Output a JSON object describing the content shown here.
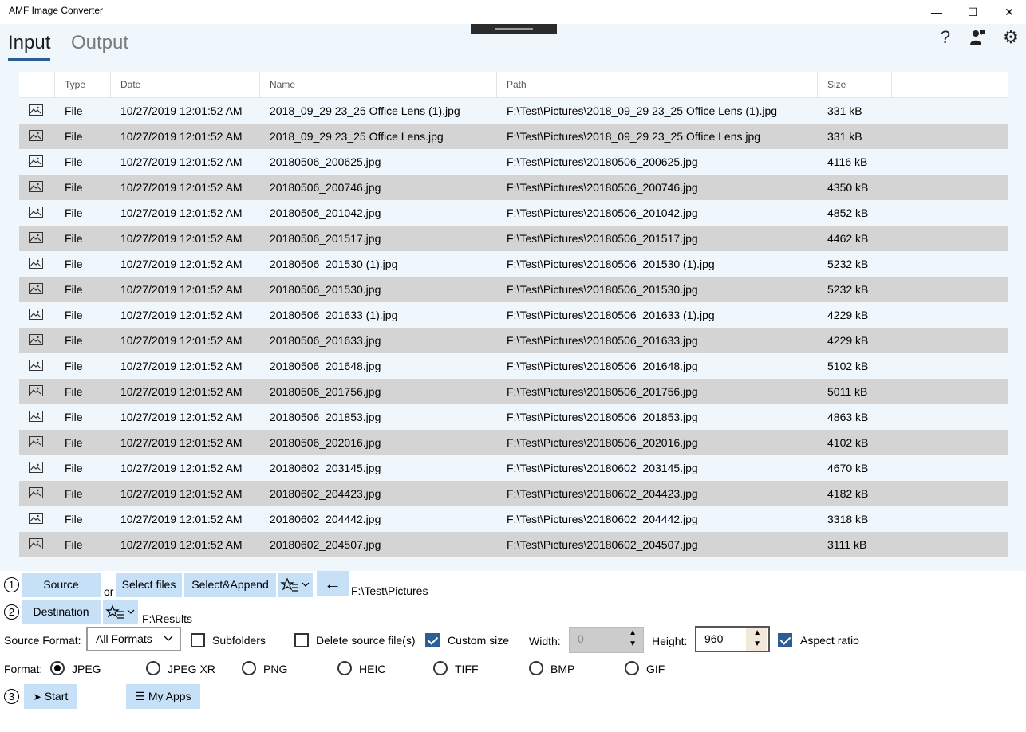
{
  "window": {
    "title": "AMF Image Converter",
    "minimize_icon": "—",
    "maximize_icon": "☐",
    "close_icon": "✕"
  },
  "tabs": {
    "input": "Input",
    "output": "Output"
  },
  "top_icons": {
    "help": "?",
    "settings": "⚙"
  },
  "grid": {
    "headers": {
      "icon": "",
      "type": "Type",
      "date": "Date",
      "name": "Name",
      "path": "Path",
      "size": "Size"
    },
    "rows": [
      {
        "type": "File",
        "date": "10/27/2019 12:01:52 AM",
        "name": "2018_09_29 23_25 Office Lens (1).jpg",
        "path": "F:\\Test\\Pictures\\2018_09_29 23_25 Office Lens (1).jpg",
        "size": "331 kB"
      },
      {
        "type": "File",
        "date": "10/27/2019 12:01:52 AM",
        "name": "2018_09_29 23_25 Office Lens.jpg",
        "path": "F:\\Test\\Pictures\\2018_09_29 23_25 Office Lens.jpg",
        "size": "331 kB"
      },
      {
        "type": "File",
        "date": "10/27/2019 12:01:52 AM",
        "name": "20180506_200625.jpg",
        "path": "F:\\Test\\Pictures\\20180506_200625.jpg",
        "size": "4116 kB"
      },
      {
        "type": "File",
        "date": "10/27/2019 12:01:52 AM",
        "name": "20180506_200746.jpg",
        "path": "F:\\Test\\Pictures\\20180506_200746.jpg",
        "size": "4350 kB"
      },
      {
        "type": "File",
        "date": "10/27/2019 12:01:52 AM",
        "name": "20180506_201042.jpg",
        "path": "F:\\Test\\Pictures\\20180506_201042.jpg",
        "size": "4852 kB"
      },
      {
        "type": "File",
        "date": "10/27/2019 12:01:52 AM",
        "name": "20180506_201517.jpg",
        "path": "F:\\Test\\Pictures\\20180506_201517.jpg",
        "size": "4462 kB"
      },
      {
        "type": "File",
        "date": "10/27/2019 12:01:52 AM",
        "name": "20180506_201530 (1).jpg",
        "path": "F:\\Test\\Pictures\\20180506_201530 (1).jpg",
        "size": "5232 kB"
      },
      {
        "type": "File",
        "date": "10/27/2019 12:01:52 AM",
        "name": "20180506_201530.jpg",
        "path": "F:\\Test\\Pictures\\20180506_201530.jpg",
        "size": "5232 kB"
      },
      {
        "type": "File",
        "date": "10/27/2019 12:01:52 AM",
        "name": "20180506_201633 (1).jpg",
        "path": "F:\\Test\\Pictures\\20180506_201633 (1).jpg",
        "size": "4229 kB"
      },
      {
        "type": "File",
        "date": "10/27/2019 12:01:52 AM",
        "name": "20180506_201633.jpg",
        "path": "F:\\Test\\Pictures\\20180506_201633.jpg",
        "size": "4229 kB"
      },
      {
        "type": "File",
        "date": "10/27/2019 12:01:52 AM",
        "name": "20180506_201648.jpg",
        "path": "F:\\Test\\Pictures\\20180506_201648.jpg",
        "size": "5102 kB"
      },
      {
        "type": "File",
        "date": "10/27/2019 12:01:52 AM",
        "name": "20180506_201756.jpg",
        "path": "F:\\Test\\Pictures\\20180506_201756.jpg",
        "size": "5011 kB"
      },
      {
        "type": "File",
        "date": "10/27/2019 12:01:52 AM",
        "name": "20180506_201853.jpg",
        "path": "F:\\Test\\Pictures\\20180506_201853.jpg",
        "size": "4863 kB"
      },
      {
        "type": "File",
        "date": "10/27/2019 12:01:52 AM",
        "name": "20180506_202016.jpg",
        "path": "F:\\Test\\Pictures\\20180506_202016.jpg",
        "size": "4102 kB"
      },
      {
        "type": "File",
        "date": "10/27/2019 12:01:52 AM",
        "name": "20180602_203145.jpg",
        "path": "F:\\Test\\Pictures\\20180602_203145.jpg",
        "size": "4670 kB"
      },
      {
        "type": "File",
        "date": "10/27/2019 12:01:52 AM",
        "name": "20180602_204423.jpg",
        "path": "F:\\Test\\Pictures\\20180602_204423.jpg",
        "size": "4182 kB"
      },
      {
        "type": "File",
        "date": "10/27/2019 12:01:52 AM",
        "name": "20180602_204442.jpg",
        "path": "F:\\Test\\Pictures\\20180602_204442.jpg",
        "size": "3318 kB"
      },
      {
        "type": "File",
        "date": "10/27/2019 12:01:52 AM",
        "name": "20180602_204507.jpg",
        "path": "F:\\Test\\Pictures\\20180602_204507.jpg",
        "size": "3111 kB"
      }
    ]
  },
  "controls": {
    "step1": "1",
    "step2": "2",
    "step3": "3",
    "source_button": "Source",
    "or_label": "or",
    "select_files_button": "Select files",
    "select_append_button": "Select&Append",
    "back_icon": "←",
    "source_path": "F:\\Test\\Pictures",
    "destination_button": "Destination",
    "destination_path": "F:\\Results",
    "source_format_label": "Source Format:",
    "source_format_value": "All Formats",
    "subfolders_label": "Subfolders",
    "delete_source_label": "Delete source file(s)",
    "custom_size_label": "Custom size",
    "width_label": "Width:",
    "width_value": "0",
    "height_label": "Height:",
    "height_value": "960",
    "aspect_ratio_label": "Aspect ratio",
    "format_label": "Format:",
    "formats": [
      "JPEG",
      "JPEG XR",
      "PNG",
      "HEIC",
      "TIFF",
      "BMP",
      "GIF"
    ],
    "selected_format": "JPEG",
    "start_button": "Start",
    "my_apps_button": "My Apps"
  },
  "colors": {
    "accent": "#2b5f93",
    "button_bg": "#c6e0f8",
    "row_alt": "#d4d4d4",
    "panel_bg": "#eff6fc"
  }
}
